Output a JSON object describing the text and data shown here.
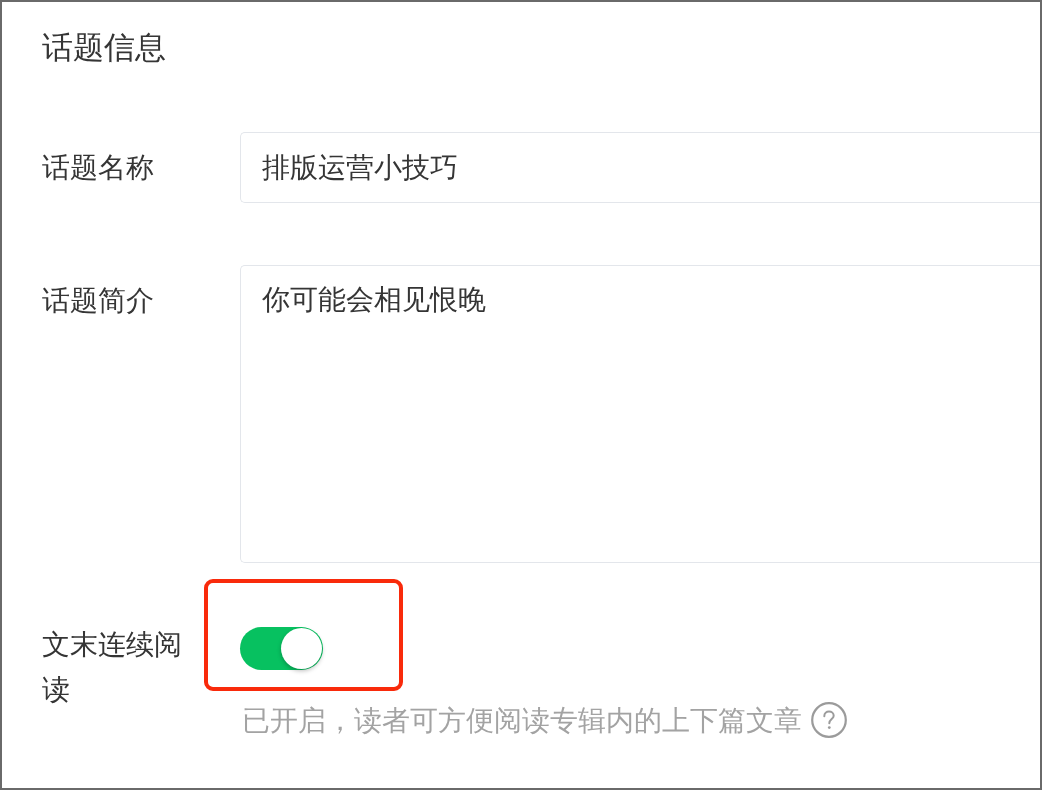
{
  "section_title": "话题信息",
  "fields": [
    {
      "kind": "text",
      "label": "话题名称",
      "value": "排版运营小技巧"
    },
    {
      "kind": "textarea",
      "label": "话题简介",
      "value": "你可能会相见恨晚"
    },
    {
      "kind": "switch",
      "label": "文末连续阅读",
      "on": true,
      "highlighted": true,
      "hint": "已开启，读者可方便阅读专辑内的上下篇文章"
    }
  ]
}
